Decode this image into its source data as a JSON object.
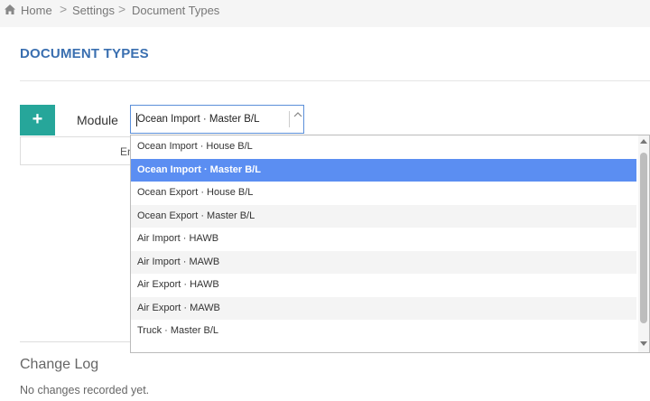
{
  "breadcrumb": {
    "items": [
      "Home",
      "Settings",
      "Document Types"
    ],
    "separator": ">"
  },
  "page": {
    "title": "DOCUMENT TYPES"
  },
  "toolbar": {
    "add_label": "+",
    "module_label": "Module",
    "module_value": "Ocean Import · Master B/L"
  },
  "table": {
    "header_partial": "En"
  },
  "dropdown": {
    "options": [
      {
        "label": "Ocean Import · House B/L"
      },
      {
        "label": "Ocean Import · Master B/L"
      },
      {
        "label": "Ocean Export · House B/L"
      },
      {
        "label": "Ocean Export · Master B/L"
      },
      {
        "label": "Air Import · HAWB"
      },
      {
        "label": "Air Import · MAWB"
      },
      {
        "label": "Air Export · HAWB"
      },
      {
        "label": "Air Export · MAWB"
      },
      {
        "label": "Truck · Master B/L"
      }
    ],
    "selected_index": 1
  },
  "changelog": {
    "title": "Change Log",
    "empty_text": "No changes recorded yet."
  },
  "colors": {
    "accent": "#26a69a",
    "title": "#3a6fb0",
    "highlight": "#5b8ef2"
  }
}
